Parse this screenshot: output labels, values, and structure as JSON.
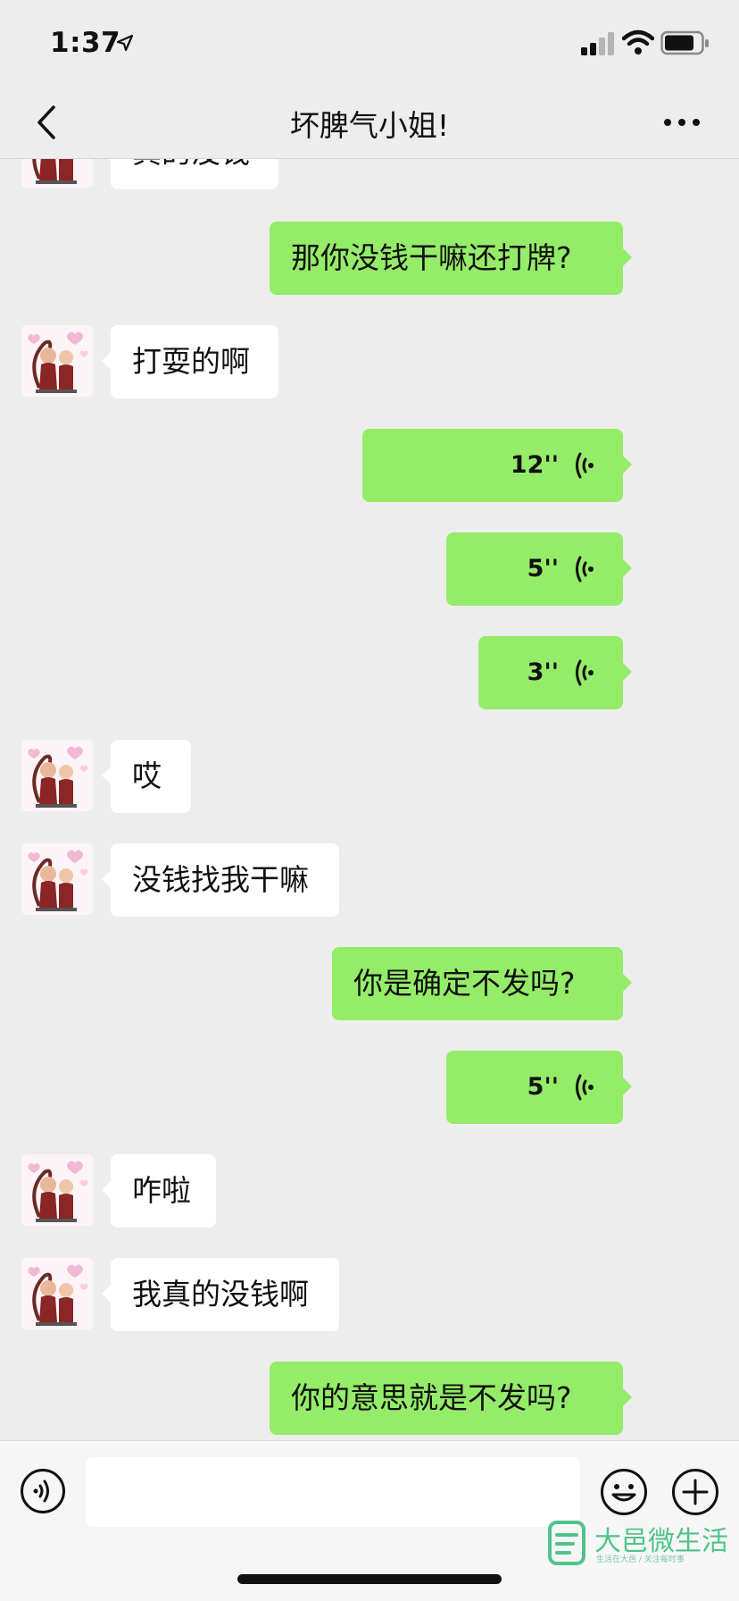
{
  "status_bar": {
    "time": "1:37"
  },
  "nav": {
    "title": "坏脾气小姐!"
  },
  "messages": [
    {
      "from": "them",
      "type": "text",
      "text": "真的没钱"
    },
    {
      "from": "me",
      "type": "text",
      "text": "那你没钱干嘛还打牌?"
    },
    {
      "from": "them",
      "type": "text",
      "text": "打耍的啊"
    },
    {
      "from": "me",
      "type": "voice",
      "duration": "12''"
    },
    {
      "from": "me",
      "type": "voice",
      "duration": "5''"
    },
    {
      "from": "me",
      "type": "voice",
      "duration": "3''"
    },
    {
      "from": "them",
      "type": "text",
      "text": "哎"
    },
    {
      "from": "them",
      "type": "text",
      "text": "没钱找我干嘛"
    },
    {
      "from": "me",
      "type": "text",
      "text": "你是确定不发吗?"
    },
    {
      "from": "me",
      "type": "voice",
      "duration": "5''"
    },
    {
      "from": "them",
      "type": "text",
      "text": "咋啦"
    },
    {
      "from": "them",
      "type": "text",
      "text": "我真的没钱啊"
    },
    {
      "from": "me",
      "type": "text",
      "text": "你的意思就是不发吗?"
    }
  ],
  "watermark": {
    "title": "大邑微生活",
    "subtitle": "生活在大邑 / 关注每时事"
  },
  "colors": {
    "background": "#ededed",
    "outgoing_bubble": "#95ec69",
    "incoming_bubble": "#ffffff",
    "watermark": "#4fc48a"
  },
  "icons": {
    "status": [
      "location-arrow-icon",
      "signal-icon",
      "wifi-icon",
      "battery-icon"
    ],
    "nav": [
      "back-chevron-icon",
      "more-icon"
    ],
    "input": [
      "voice-toggle-icon",
      "emoji-icon",
      "plus-icon"
    ]
  }
}
